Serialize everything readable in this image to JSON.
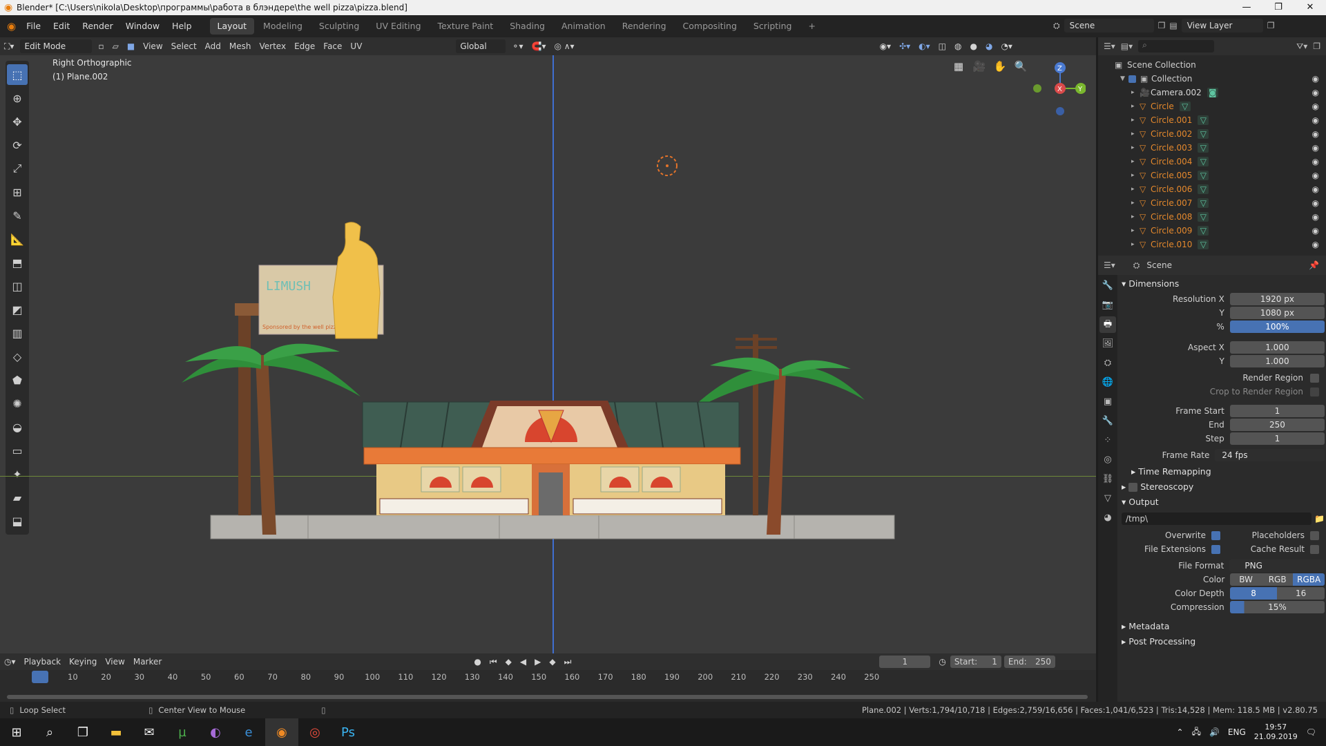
{
  "window": {
    "title": "Blender* [C:\\Users\\nikola\\Desktop\\программы\\работа в блэндере\\the well pizza\\pizza.blend]",
    "controls": [
      "—",
      "❐",
      "✕"
    ]
  },
  "topbar": {
    "menus": [
      "File",
      "Edit",
      "Render",
      "Window",
      "Help"
    ],
    "workspaces": [
      "Layout",
      "Modeling",
      "Sculpting",
      "UV Editing",
      "Texture Paint",
      "Shading",
      "Animation",
      "Rendering",
      "Compositing",
      "Scripting"
    ],
    "active_workspace": "Layout",
    "add_tab": "+",
    "scene": "Scene",
    "view_layer": "View Layer"
  },
  "viewport": {
    "mode": "Edit Mode",
    "menus": [
      "View",
      "Select",
      "Add",
      "Mesh",
      "Vertex",
      "Edge",
      "Face",
      "UV"
    ],
    "transform_orientation": "Global",
    "view_name": "Right Orthographic",
    "object_info": "(1) Plane.002",
    "billboard_text": "LIMUSH",
    "billboard_sub": "Sponsored by the well pizza",
    "gizmo": {
      "z": "Z",
      "x": "X",
      "y": "Y"
    },
    "colors": {
      "bg": "#3b3b3b",
      "roof": "#3f5d52",
      "wall": "#e87a38",
      "sign": "#d9a34a",
      "palm": "#2f8f3a",
      "trunk": "#7a4a2b",
      "ground": "#b5b3ae"
    }
  },
  "outliner": {
    "root": "Scene Collection",
    "collection": "Collection",
    "items": [
      {
        "name": "Camera.002",
        "color": "#d6d6d6"
      },
      {
        "name": "Circle",
        "color": "#e5892d"
      },
      {
        "name": "Circle.001",
        "color": "#e5892d"
      },
      {
        "name": "Circle.002",
        "color": "#e5892d"
      },
      {
        "name": "Circle.003",
        "color": "#e5892d"
      },
      {
        "name": "Circle.004",
        "color": "#e5892d"
      },
      {
        "name": "Circle.005",
        "color": "#e5892d"
      },
      {
        "name": "Circle.006",
        "color": "#e5892d"
      },
      {
        "name": "Circle.007",
        "color": "#e5892d"
      },
      {
        "name": "Circle.008",
        "color": "#e5892d"
      },
      {
        "name": "Circle.009",
        "color": "#e5892d"
      },
      {
        "name": "Circle.010",
        "color": "#e5892d"
      }
    ]
  },
  "properties": {
    "context": "Scene",
    "dimensions": {
      "header": "Dimensions",
      "res_x_label": "Resolution X",
      "res_x": "1920 px",
      "res_y_label": "Y",
      "res_y": "1080 px",
      "pct_label": "%",
      "pct": "100%",
      "aspect_x_label": "Aspect X",
      "aspect_x": "1.000",
      "aspect_y_label": "Y",
      "aspect_y": "1.000",
      "render_region": "Render Region",
      "crop_region": "Crop to Render Region",
      "frame_start_label": "Frame Start",
      "frame_start": "1",
      "end_label": "End",
      "end": "250",
      "step_label": "Step",
      "step": "1",
      "frame_rate_label": "Frame Rate",
      "frame_rate": "24 fps",
      "time_remapping": "Time Remapping"
    },
    "stereoscopy": "Stereoscopy",
    "output": {
      "header": "Output",
      "path": "/tmp\\",
      "overwrite": "Overwrite",
      "placeholders": "Placeholders",
      "file_extensions": "File Extensions",
      "cache_result": "Cache Result",
      "file_format_label": "File Format",
      "file_format": "PNG",
      "color_label": "Color",
      "color_options": [
        "BW",
        "RGB",
        "RGBA"
      ],
      "color_selected": "RGBA",
      "depth_label": "Color Depth",
      "depth_options": [
        "8",
        "16"
      ],
      "depth_selected": "8",
      "compression_label": "Compression",
      "compression": "15%"
    },
    "metadata": "Metadata",
    "post_processing": "Post Processing"
  },
  "timeline": {
    "menus": [
      "Playback",
      "Keying",
      "View",
      "Marker"
    ],
    "current_frame": "1",
    "start_label": "Start:",
    "start": "1",
    "end_label": "End:",
    "end": "250",
    "ticks": [
      "1",
      "10",
      "20",
      "30",
      "40",
      "50",
      "60",
      "70",
      "80",
      "90",
      "100",
      "110",
      "120",
      "130",
      "140",
      "150",
      "160",
      "170",
      "180",
      "190",
      "200",
      "210",
      "220",
      "230",
      "240",
      "250"
    ]
  },
  "statusbar": {
    "left_hint": "Loop Select",
    "mid_hint": "Center View to Mouse",
    "stats": "Plane.002 | Verts:1,794/10,718 | Edges:2,759/16,656 | Faces:1,041/6,523 | Tris:14,528 | Mem: 118.5 MB | v2.80.75"
  },
  "taskbar": {
    "lang": "ENG",
    "time": "19:57",
    "date": "21.09.2019"
  }
}
